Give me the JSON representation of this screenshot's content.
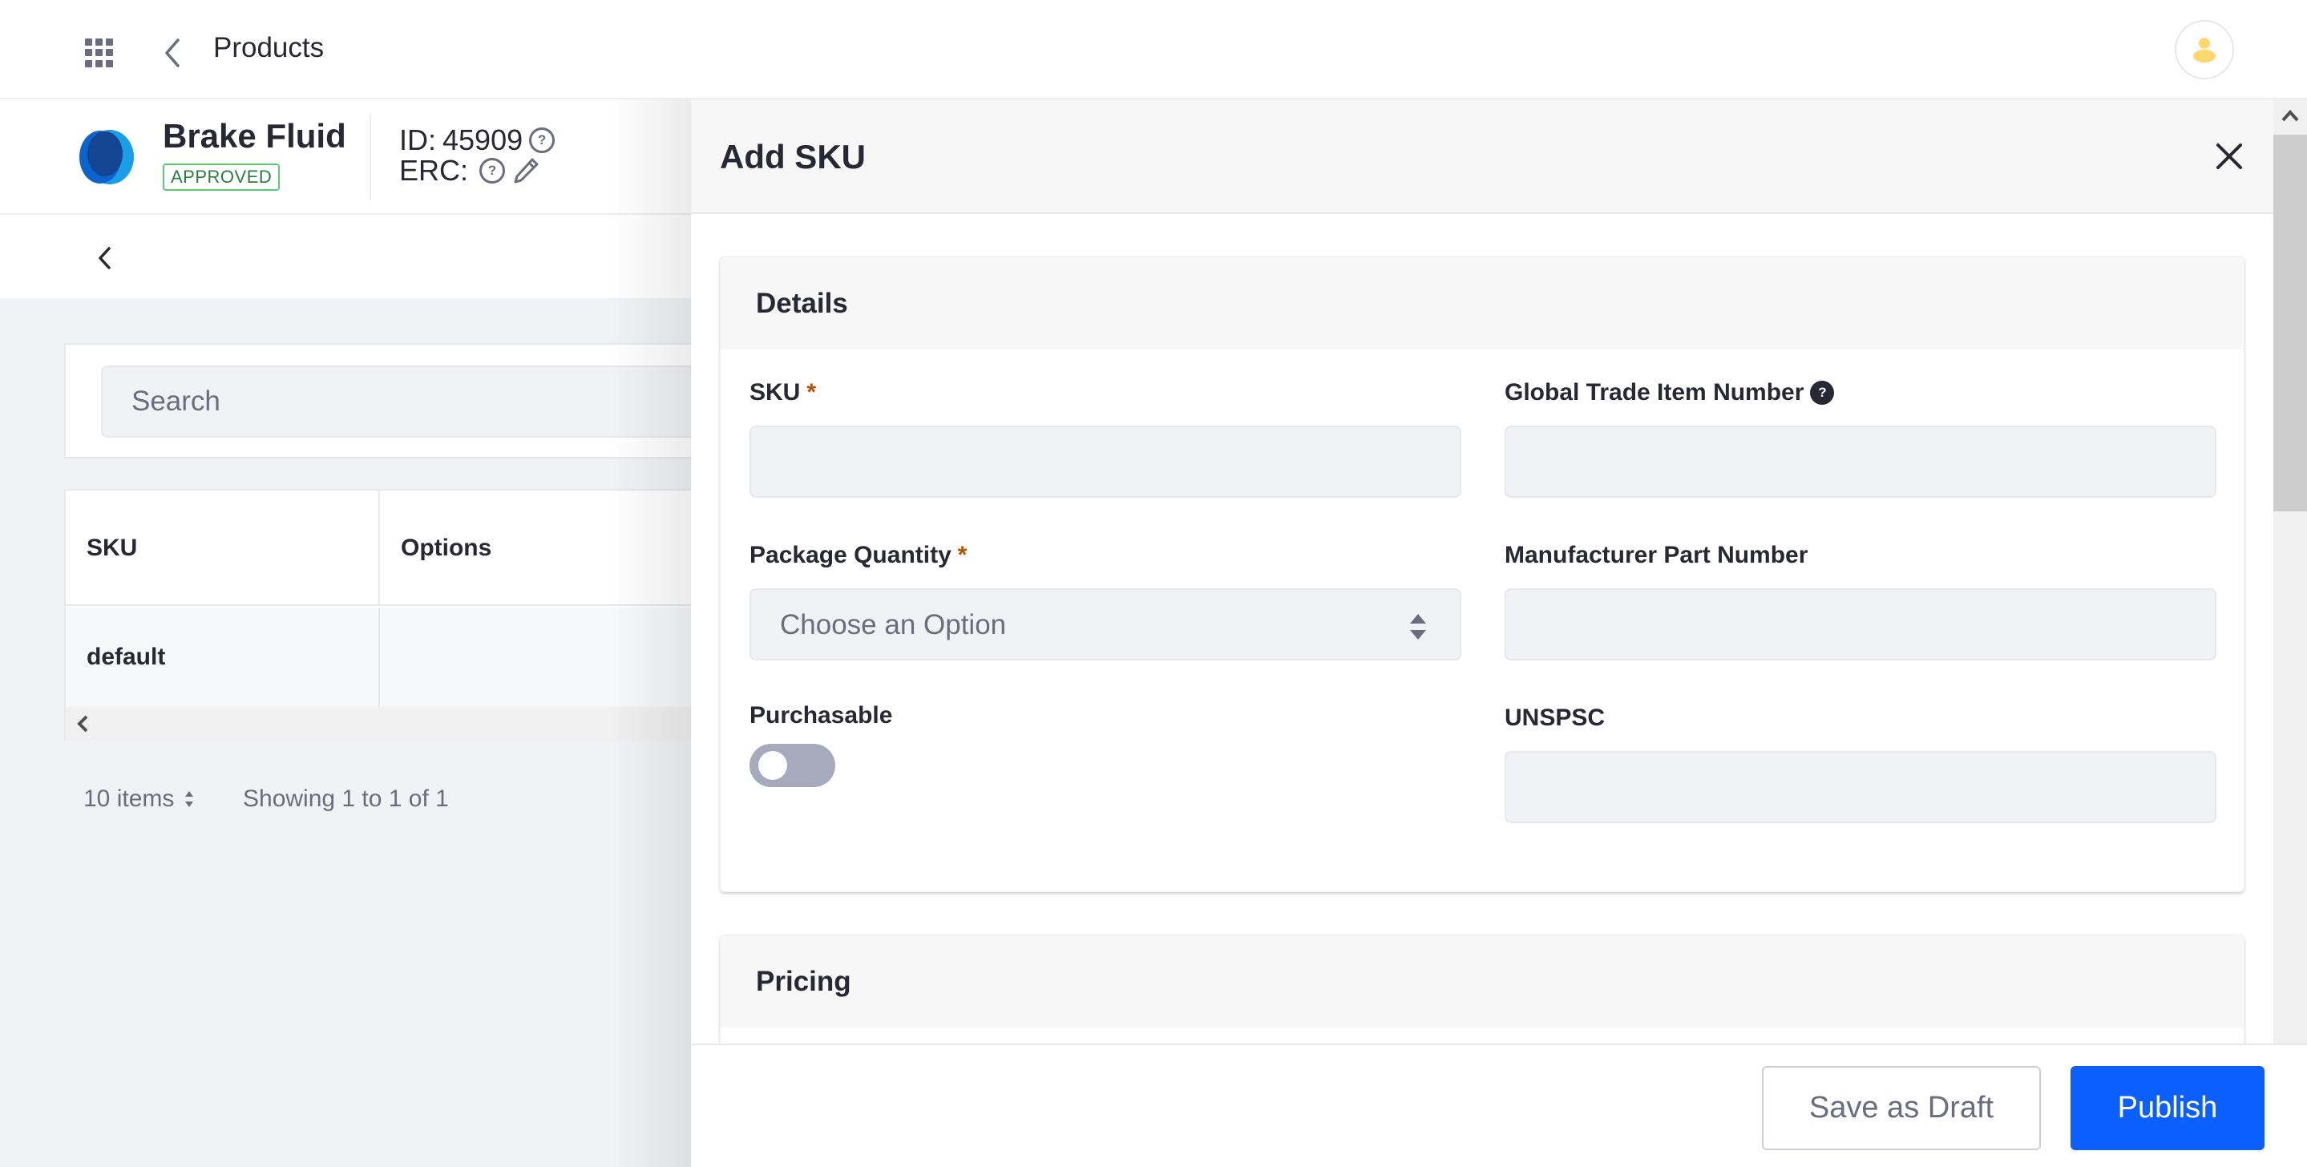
{
  "topbar": {
    "title": "Products",
    "apps_icon": "apps-grid-icon",
    "back_icon": "chevron-left-icon",
    "avatar_icon": "user-icon"
  },
  "product": {
    "name": "Brake Fluid",
    "status": "APPROVED",
    "id_label": "ID:",
    "id_value": "45909",
    "erc_label": "ERC:",
    "help_glyph": "?"
  },
  "list": {
    "search_placeholder": "Search",
    "columns": [
      "SKU",
      "Options"
    ],
    "rows": [
      {
        "sku": "default",
        "options": ""
      }
    ],
    "page_size": "10 items",
    "showing": "Showing 1 to 1 of 1"
  },
  "panel": {
    "title": "Add SKU",
    "details": {
      "title": "Details",
      "sku_label": "SKU",
      "sku_value": "",
      "package_quantity_label": "Package Quantity",
      "package_quantity_value": "Choose an Option",
      "purchasable_label": "Purchasable",
      "purchasable_on": false,
      "gtin_label": "Global Trade Item Number",
      "gtin_value": "",
      "mpn_label": "Manufacturer Part Number",
      "mpn_value": "",
      "unspsc_label": "UNSPSC",
      "unspsc_value": "",
      "required_mark": "*",
      "help_glyph": "?"
    },
    "pricing": {
      "title": "Pricing"
    },
    "footer": {
      "save_draft_label": "Save as Draft",
      "publish_label": "Publish"
    }
  },
  "colors": {
    "primary": "#0b5fff",
    "approved_text": "#287d3c",
    "approved_border": "#5aca75",
    "required": "#b95000",
    "avatar": "#ffd76e"
  }
}
